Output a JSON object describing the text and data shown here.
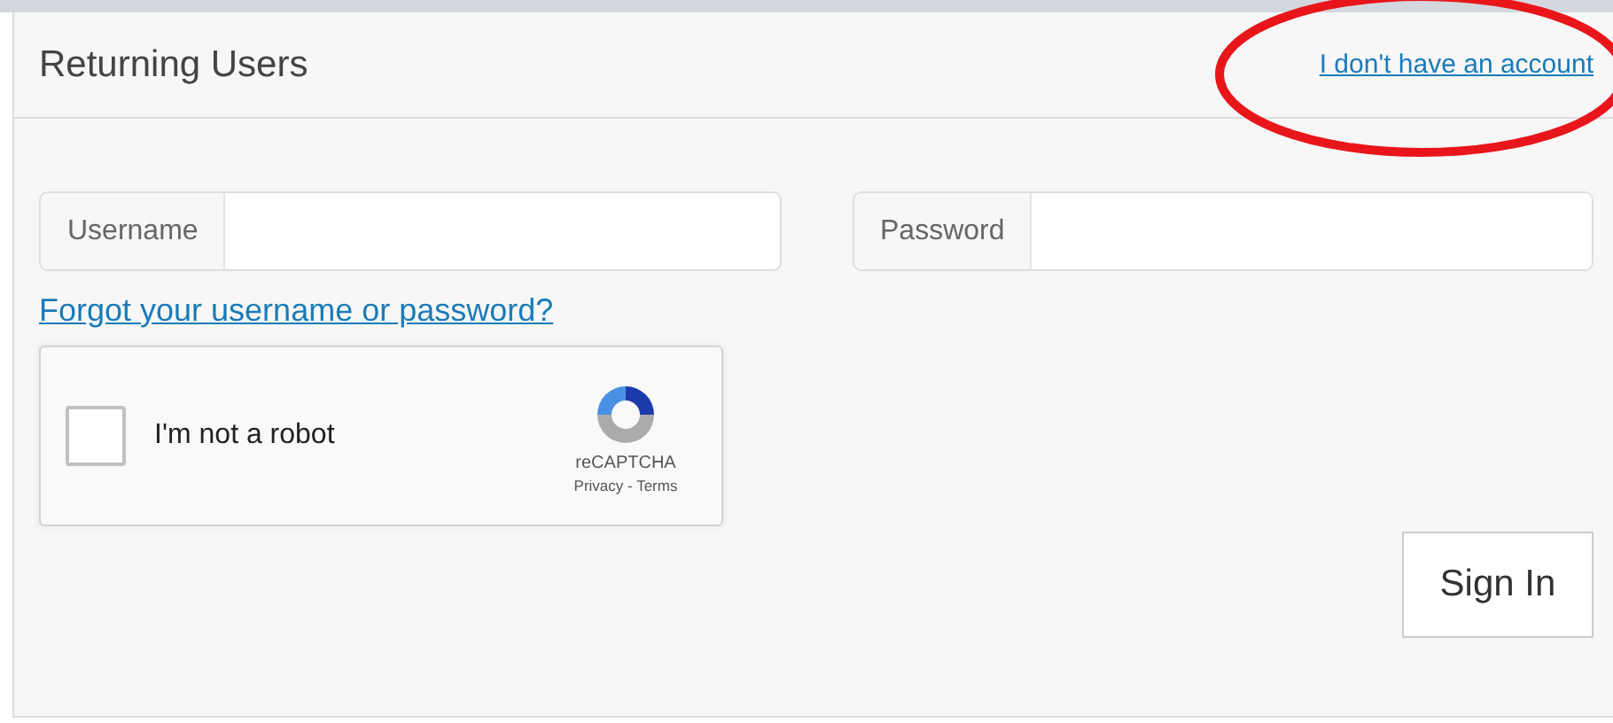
{
  "panel": {
    "title": "Returning Users",
    "account_link": "I don't have an account"
  },
  "fields": [
    {
      "label": "Username"
    },
    {
      "label": "Password"
    }
  ],
  "forgot_link": "Forgot your username or password?",
  "captcha": {
    "label": "I'm not a robot",
    "checked": false,
    "brand": "reCAPTCHA",
    "links": "Privacy - Terms"
  },
  "submit": "Sign In"
}
